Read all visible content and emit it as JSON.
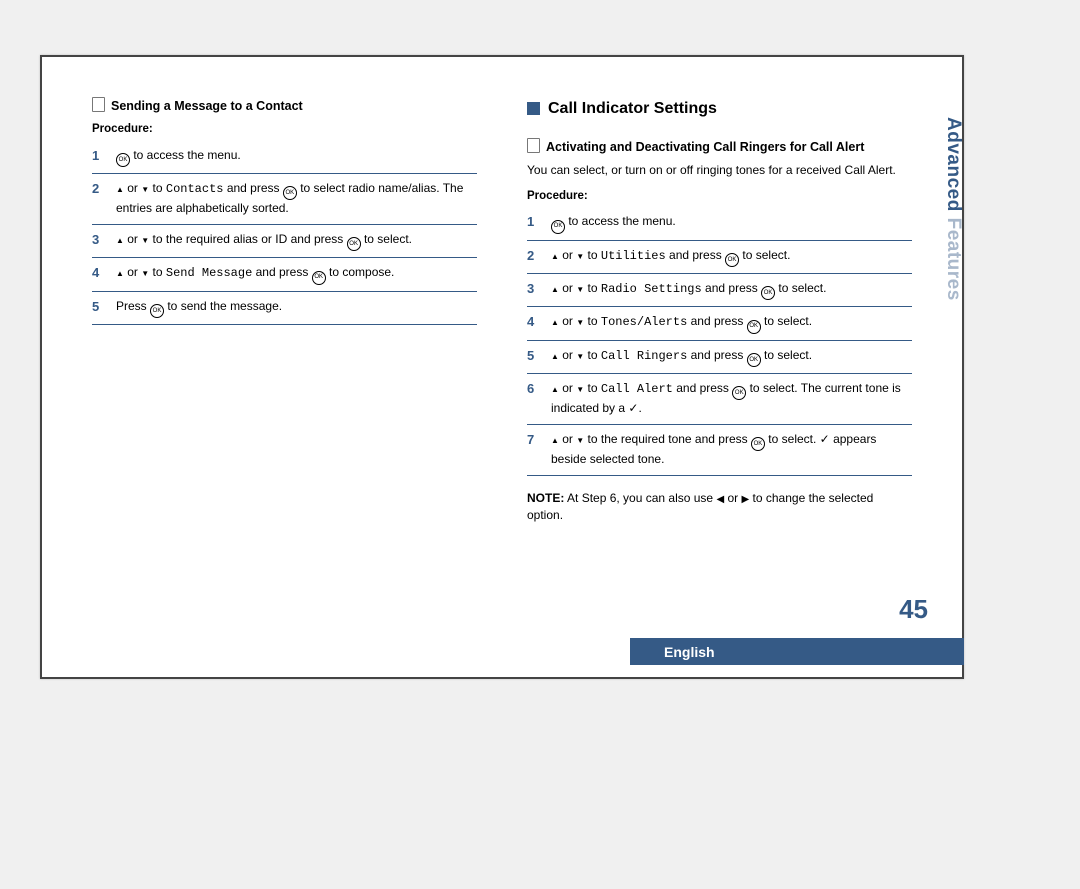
{
  "page_number": "45",
  "side_tab_primary": "Advanced",
  "side_tab_secondary": " Features",
  "language_bar": "English",
  "left": {
    "heading": "Sending a Message to a Contact",
    "procedure_label": "Procedure:",
    "steps": [
      {
        "num": "1",
        "parts": [
          {
            "icon": "ok"
          },
          {
            "t": " to access the  menu."
          }
        ]
      },
      {
        "num": "2",
        "parts": [
          {
            "icon": "up"
          },
          {
            "t": " or "
          },
          {
            "icon": "down"
          },
          {
            "t": " to "
          },
          {
            "mono": "Contacts"
          },
          {
            "t": " and press "
          },
          {
            "icon": "ok"
          },
          {
            "t": " to select radio name/alias. The entries are alphabetically sorted."
          }
        ]
      },
      {
        "num": "3",
        "parts": [
          {
            "icon": "up"
          },
          {
            "t": " or "
          },
          {
            "icon": "down"
          },
          {
            "t": " to the required alias or ID and press "
          },
          {
            "icon": "ok"
          },
          {
            "t": " to select."
          }
        ]
      },
      {
        "num": "4",
        "parts": [
          {
            "icon": "up"
          },
          {
            "t": " or "
          },
          {
            "icon": "down"
          },
          {
            "t": " to "
          },
          {
            "mono": "Send Message"
          },
          {
            "t": " and press "
          },
          {
            "icon": "ok"
          },
          {
            "t": " to compose."
          }
        ]
      },
      {
        "num": "5",
        "parts": [
          {
            "t": "Press "
          },
          {
            "icon": "ok"
          },
          {
            "t": " to send the message."
          }
        ]
      }
    ]
  },
  "right": {
    "section_title": "Call Indicator Settings",
    "heading": "Activating and Deactivating Call Ringers for Call Alert",
    "intro": "You can select, or turn on or off ringing tones for a received Call Alert.",
    "procedure_label": "Procedure:",
    "steps": [
      {
        "num": "1",
        "parts": [
          {
            "icon": "ok"
          },
          {
            "t": " to access the menu."
          }
        ]
      },
      {
        "num": "2",
        "parts": [
          {
            "icon": "up"
          },
          {
            "t": " or "
          },
          {
            "icon": "down"
          },
          {
            "t": " to "
          },
          {
            "mono": "Utilities"
          },
          {
            "t": " and press "
          },
          {
            "icon": "ok"
          },
          {
            "t": " to select."
          }
        ]
      },
      {
        "num": "3",
        "parts": [
          {
            "icon": "up"
          },
          {
            "t": " or "
          },
          {
            "icon": "down"
          },
          {
            "t": " to "
          },
          {
            "mono": "Radio Settings"
          },
          {
            "t": " and press "
          },
          {
            "icon": "ok"
          },
          {
            "t": " to select."
          }
        ]
      },
      {
        "num": "4",
        "parts": [
          {
            "icon": "up"
          },
          {
            "t": " or "
          },
          {
            "icon": "down"
          },
          {
            "t": " to "
          },
          {
            "mono": "Tones/Alerts"
          },
          {
            "t": " and press "
          },
          {
            "icon": "ok"
          },
          {
            "t": " to select."
          }
        ]
      },
      {
        "num": "5",
        "parts": [
          {
            "icon": "up"
          },
          {
            "t": " or "
          },
          {
            "icon": "down"
          },
          {
            "t": " to "
          },
          {
            "mono": "Call Ringers"
          },
          {
            "t": " and press "
          },
          {
            "icon": "ok"
          },
          {
            "t": " to select."
          }
        ]
      },
      {
        "num": "6",
        "parts": [
          {
            "icon": "up"
          },
          {
            "t": " or "
          },
          {
            "icon": "down"
          },
          {
            "t": " to "
          },
          {
            "mono": "Call Alert"
          },
          {
            "t": " and press "
          },
          {
            "icon": "ok"
          },
          {
            "t": " to select. The current tone is indicated by a "
          },
          {
            "icon": "check"
          },
          {
            "t": "."
          }
        ]
      },
      {
        "num": "7",
        "parts": [
          {
            "icon": "up"
          },
          {
            "t": " or "
          },
          {
            "icon": "down"
          },
          {
            "t": " to the required tone and press "
          },
          {
            "icon": "ok"
          },
          {
            "t": " to select. "
          },
          {
            "icon": "check"
          },
          {
            "t": " appears beside selected tone."
          }
        ]
      }
    ],
    "note_label": "NOTE:",
    "note_parts": [
      {
        "t": "  At Step 6, you can also use "
      },
      {
        "icon": "left"
      },
      {
        "t": " or "
      },
      {
        "icon": "right"
      },
      {
        "t": " to change the selected option."
      }
    ]
  }
}
